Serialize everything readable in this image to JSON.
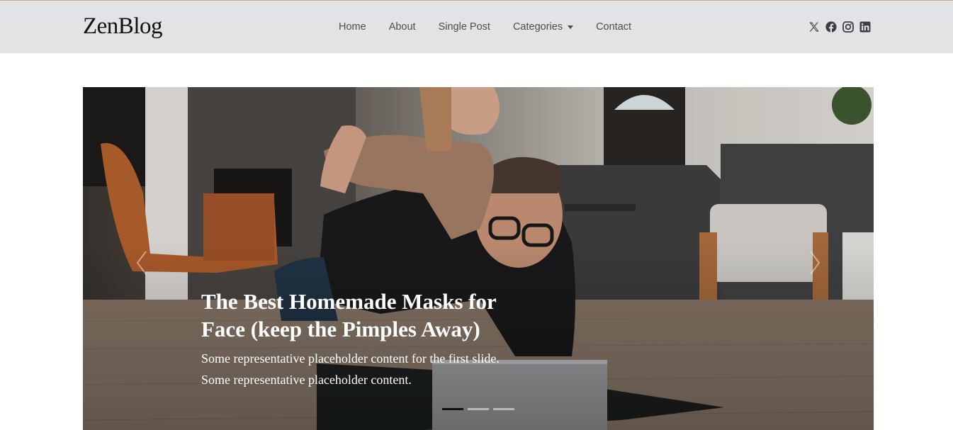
{
  "brand": {
    "name": "ZenBlog"
  },
  "nav": {
    "home": "Home",
    "about": "About",
    "single_post": "Single Post",
    "categories": "Categories",
    "contact": "Contact"
  },
  "social": [
    "x-icon",
    "facebook-icon",
    "instagram-icon",
    "linkedin-icon"
  ],
  "hero": {
    "title": "The Best Homemade Masks for Face (keep the Pimples Away)",
    "text": "Some representative placeholder content for the first slide. Some representative placeholder content.",
    "slide_count": 3,
    "active_slide": 1
  },
  "colors": {
    "header_bg": "#e2e3e5",
    "nav_text": "#4a4d52",
    "caption_text": "#ffffff"
  }
}
